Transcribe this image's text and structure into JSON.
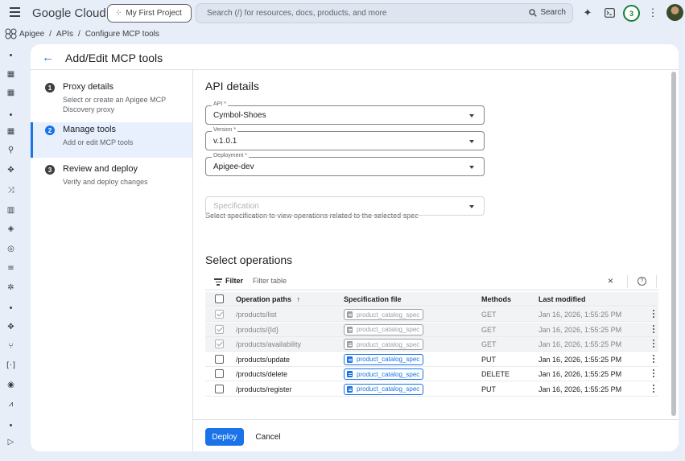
{
  "topbar": {
    "brand": "Google Cloud",
    "project": "My First Project",
    "search_placeholder": "Search (/) for resources, docs, products, and more",
    "search_button": "Search",
    "notification_count": "3"
  },
  "breadcrumb": {
    "items": [
      "Apigee",
      "APIs",
      "Configure MCP tools"
    ],
    "separator": "/"
  },
  "panel": {
    "title": "Add/Edit MCP tools"
  },
  "steps": [
    {
      "num": "1",
      "title": "Proxy details",
      "desc": "Select or create an Apigee MCP Discovery proxy"
    },
    {
      "num": "2",
      "title": "Manage tools",
      "desc": "Add or edit MCP tools",
      "active": true
    },
    {
      "num": "3",
      "title": "Review and deploy",
      "desc": "Verify and deploy changes"
    }
  ],
  "api_details": {
    "heading": "API details",
    "api": {
      "label": "API *",
      "value": "Cymbol-Shoes"
    },
    "version": {
      "label": "Version *",
      "value": "v.1.0.1"
    },
    "deployment": {
      "label": "Deployment *",
      "value": "Apigee-dev"
    },
    "hint": "Select specification to view operations related to the selected spec",
    "specification": {
      "placeholder": "Specification"
    }
  },
  "operations": {
    "heading": "Select operations",
    "filter_label": "Filter",
    "filter_placeholder": "Filter table",
    "clear": "×",
    "help": "?",
    "columns": [
      "Operation paths",
      "Specification file",
      "Methods",
      "Last modified"
    ],
    "sort_arrow": "↑",
    "rows": [
      {
        "path": "/products/list",
        "spec": "product_catalog_spec",
        "method": "GET",
        "modified": "Jan 16, 2026, 1:55:25 PM",
        "checked": true,
        "disabled": true
      },
      {
        "path": "/products/{Id}",
        "spec": "product_catalog_spec",
        "method": "GET",
        "modified": "Jan 16, 2026, 1:55:25 PM",
        "checked": true,
        "disabled": true
      },
      {
        "path": "/products/availability",
        "spec": "product_catalog_spec",
        "method": "GET",
        "modified": "Jan 16, 2026, 1:55:25 PM",
        "checked": true,
        "disabled": true
      },
      {
        "path": "/products/update",
        "spec": "product_catalog_spec",
        "method": "PUT",
        "modified": "Jan 16, 2026, 1:55:25 PM",
        "checked": false,
        "disabled": false
      },
      {
        "path": "/products/delete",
        "spec": "product_catalog_spec",
        "method": "DELETE",
        "modified": "Jan 16, 2026, 1:55:25 PM",
        "checked": false,
        "disabled": false
      },
      {
        "path": "/products/register",
        "spec": "product_catalog_spec",
        "method": "PUT",
        "modified": "Jan 16, 2026, 1:55:25 PM",
        "checked": false,
        "disabled": false
      }
    ]
  },
  "footer": {
    "deploy": "Deploy",
    "cancel": "Cancel"
  },
  "colors": {
    "accent": "#1a73e8",
    "badge": "#188038"
  }
}
